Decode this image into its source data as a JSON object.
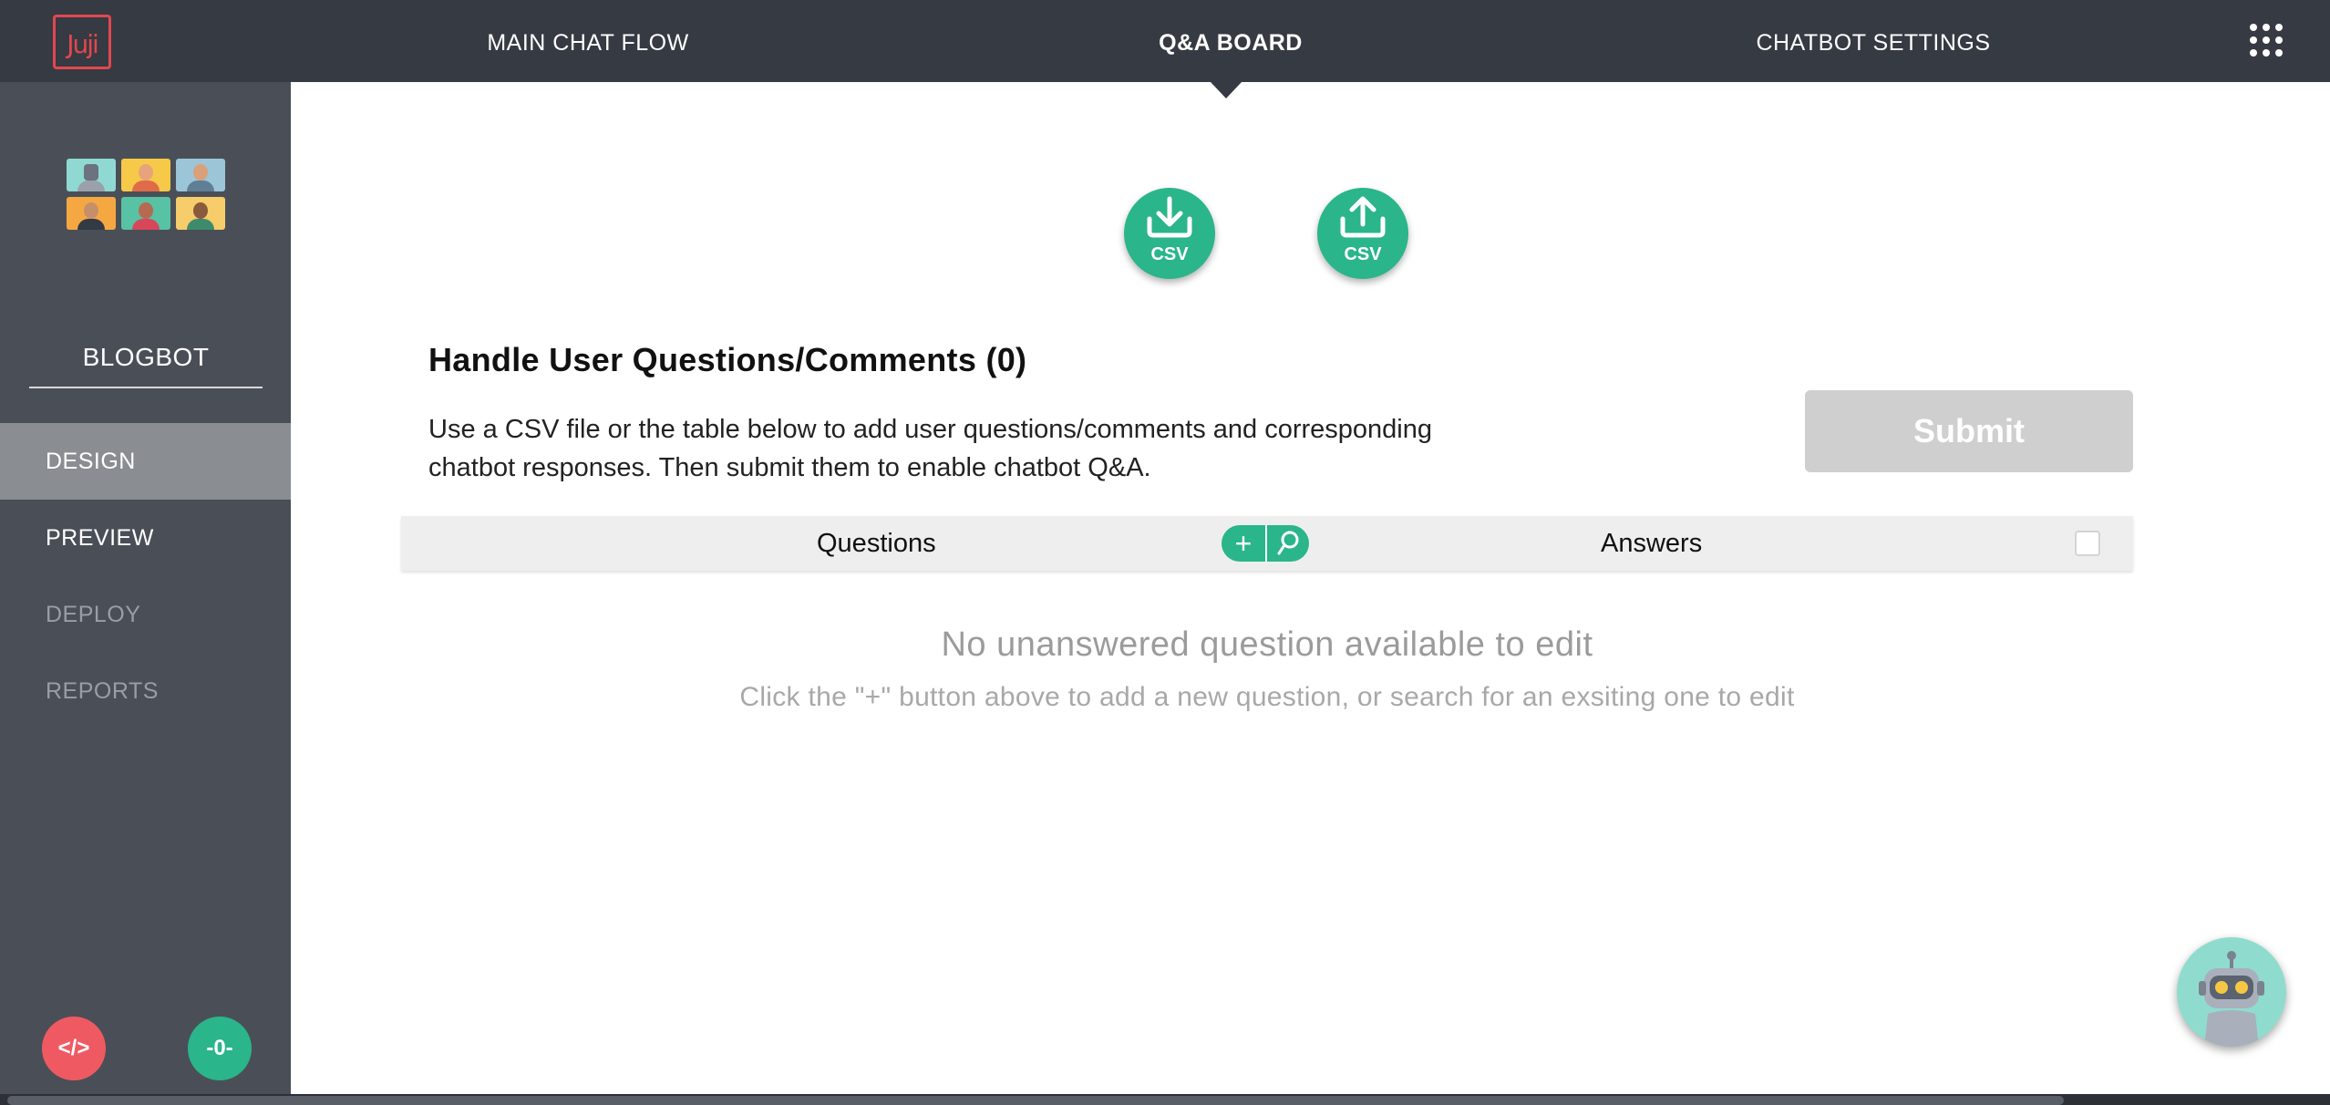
{
  "header": {
    "logo_text": "Juji",
    "tabs": [
      {
        "label": "MAIN CHAT FLOW",
        "active": false
      },
      {
        "label": "Q&A BOARD",
        "active": true
      },
      {
        "label": "CHATBOT SETTINGS",
        "active": false
      }
    ],
    "apps_icon": "grid-dots-icon"
  },
  "sidebar": {
    "bot_name": "BLOGBOT",
    "items": [
      {
        "label": "DESIGN",
        "state": "active"
      },
      {
        "label": "PREVIEW",
        "state": "enabled"
      },
      {
        "label": "DEPLOY",
        "state": "disabled"
      },
      {
        "label": "REPORTS",
        "state": "disabled"
      }
    ],
    "code_button_label": "</>",
    "status_button_label": "-0-"
  },
  "main": {
    "download_csv_label": "CSV",
    "upload_csv_label": "CSV",
    "title": "Handle User Questions/Comments (0)",
    "description": "Use a CSV file or the table below to add user questions/comments and corresponding chatbot responses. Then submit them to enable chatbot Q&A.",
    "submit_label": "Submit",
    "table": {
      "questions_header": "Questions",
      "answers_header": "Answers",
      "add_label": "+"
    },
    "empty_title": "No unanswered question available to edit",
    "empty_subtitle": "Click the \"+\" button above to add a new question, or search for an exsiting one to edit"
  },
  "colors": {
    "topbar": "#363a42",
    "sidebar": "#4a4f57",
    "accent_green": "#2ab58a",
    "logo_red": "#e2474f",
    "code_button": "#ef5a62",
    "submit_disabled": "#cfcfcf"
  }
}
